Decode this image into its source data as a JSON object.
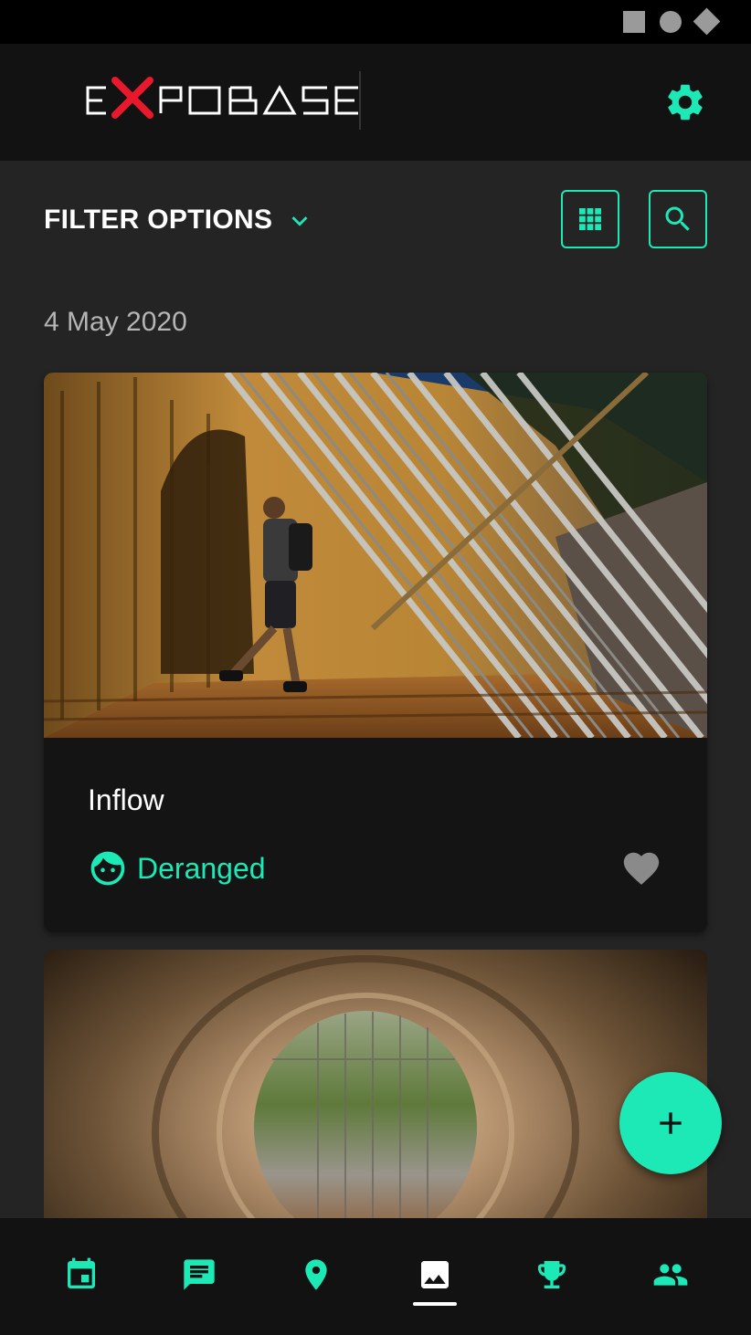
{
  "status_bar": {
    "icons": [
      "square-icon",
      "circle-icon",
      "diamond-icon"
    ]
  },
  "app_bar": {
    "logo_text": "EXPOBASE",
    "settings_icon": "gear-icon"
  },
  "filter": {
    "label": "FILTER OPTIONS",
    "chevron_icon": "chevron-down-icon",
    "grid_icon": "grid-view-icon",
    "search_icon": "search-icon"
  },
  "feed": {
    "date": "4 May 2020",
    "posts": [
      {
        "title": "Inflow",
        "author": "Deranged",
        "author_icon": "face-icon",
        "like_icon": "heart-icon",
        "image": "photo of man leaning on rusty wall under diagonal steel bars"
      },
      {
        "image": "photo looking through concrete pipe tunnel toward fence and grass"
      }
    ]
  },
  "fab": {
    "icon": "plus-icon"
  },
  "bottom_nav": {
    "items": [
      {
        "icon": "calendar-icon",
        "active": false
      },
      {
        "icon": "chat-icon",
        "active": false
      },
      {
        "icon": "location-pin-icon",
        "active": false
      },
      {
        "icon": "gallery-icon",
        "active": true
      },
      {
        "icon": "trophy-icon",
        "active": false
      },
      {
        "icon": "people-icon",
        "active": false
      }
    ]
  },
  "colors": {
    "accent": "#1de9b6",
    "background": "#242424",
    "surface": "#141414",
    "bar": "#121212",
    "logo_x": "#e8192c",
    "muted_text": "#b5b5b5",
    "heart": "#8a8a8a"
  }
}
